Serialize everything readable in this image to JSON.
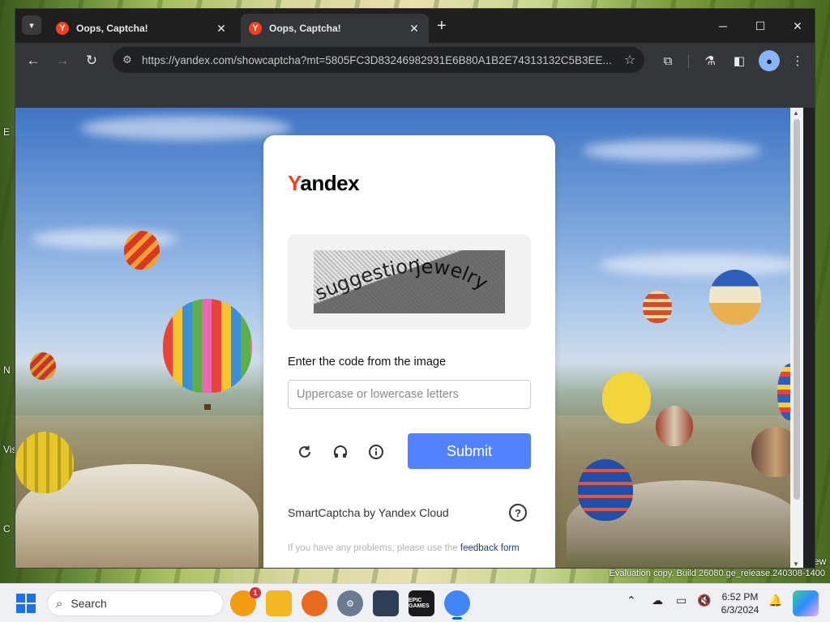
{
  "desktop": {
    "side_labels": [
      "E",
      "N",
      "Vis",
      "C"
    ],
    "watermark": "Evaluation copy. Build 26080.ge_release.240308-1400",
    "partial_label": "ew"
  },
  "browser": {
    "tabs": [
      {
        "title": "Oops, Captcha!",
        "favicon": "Y",
        "active": false
      },
      {
        "title": "Oops, Captcha!",
        "favicon": "Y",
        "active": true
      }
    ],
    "new_tab_glyph": "+",
    "url": "https://yandex.com/showcaptcha?mt=5805FC3D83246982931E6B80A1B2E74313132C5B3EE...",
    "icons": {
      "tab_dropdown": "chevron-down-icon",
      "back": "back-arrow-icon",
      "forward": "forward-arrow-icon",
      "reload": "reload-icon",
      "site_info": "site-settings-icon",
      "bookmark": "star-icon",
      "extensions": "puzzle-icon",
      "labs": "flask-icon",
      "side_panel": "side-panel-icon",
      "profile": "profile-icon",
      "menu": "kebab-menu-icon"
    }
  },
  "captcha": {
    "logo_first": "Y",
    "logo_rest": "andex",
    "captcha_text_left": "suggestion",
    "captcha_text_right": "jewelry",
    "prompt": "Enter the code from the image",
    "input_placeholder": "Uppercase or lowercase letters",
    "input_value": "",
    "submit_label": "Submit",
    "provider": "SmartCaptcha by Yandex Cloud",
    "problems_text": "If you have any problems, please use the",
    "feedback_link": "feedback form",
    "colors": {
      "accent": "#5282ff",
      "brand": "#fc3f1d"
    }
  },
  "taskbar": {
    "search_label": "Search",
    "notification_count": "1",
    "epic_label": "EPIC GAMES",
    "time": "6:52 PM",
    "date": "6/3/2024"
  }
}
